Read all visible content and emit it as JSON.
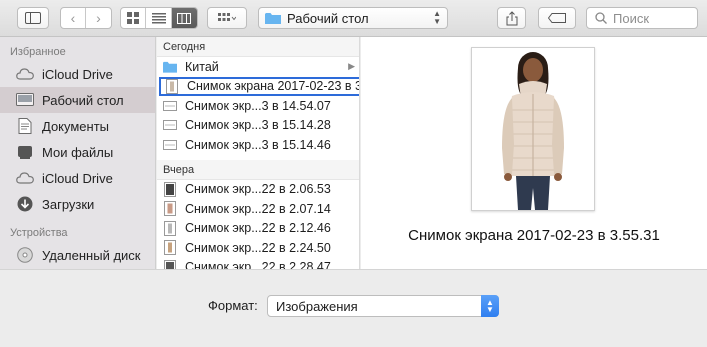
{
  "toolbar": {
    "path_label": "Рабочий стол",
    "search_placeholder": "Поиск"
  },
  "sidebar": {
    "favorites_header": "Избранное",
    "favorites": [
      {
        "label": "iCloud Drive",
        "icon": "cloud-icon"
      },
      {
        "label": "Рабочий стол",
        "icon": "desktop-icon",
        "selected": true
      },
      {
        "label": "Документы",
        "icon": "document-icon"
      },
      {
        "label": "Мои файлы",
        "icon": "all-files-icon"
      },
      {
        "label": "iCloud Drive",
        "icon": "cloud-icon"
      },
      {
        "label": "Загрузки",
        "icon": "download-icon"
      }
    ],
    "devices_header": "Устройства",
    "devices": [
      {
        "label": "Удаленный диск",
        "icon": "disc-icon"
      }
    ]
  },
  "files": {
    "today_header": "Сегодня",
    "today": [
      {
        "name": "Китай",
        "type": "folder"
      },
      {
        "name": "Снимок экрана 2017-02-23 в 3.55.31",
        "type": "image",
        "selected": true
      },
      {
        "name": "Снимок экр...3 в 14.54.07",
        "type": "screenshot"
      },
      {
        "name": "Снимок экр...3 в 15.14.28",
        "type": "screenshot"
      },
      {
        "name": "Снимок экр...3 в 15.14.46",
        "type": "screenshot"
      }
    ],
    "yesterday_header": "Вчера",
    "yesterday": [
      {
        "name": "Снимок экр...22 в 2.06.53",
        "type": "image"
      },
      {
        "name": "Снимок экр...22 в 2.07.14",
        "type": "image"
      },
      {
        "name": "Снимок экр...22 в 2.12.46",
        "type": "image"
      },
      {
        "name": "Снимок экр...22 в 2.24.50",
        "type": "image"
      },
      {
        "name": "Снимок экр...22 в 2.28.47",
        "type": "image"
      }
    ]
  },
  "preview": {
    "caption": "Снимок экрана 2017-02-23 в 3.55.31"
  },
  "format": {
    "label": "Формат:",
    "value": "Изображения"
  }
}
